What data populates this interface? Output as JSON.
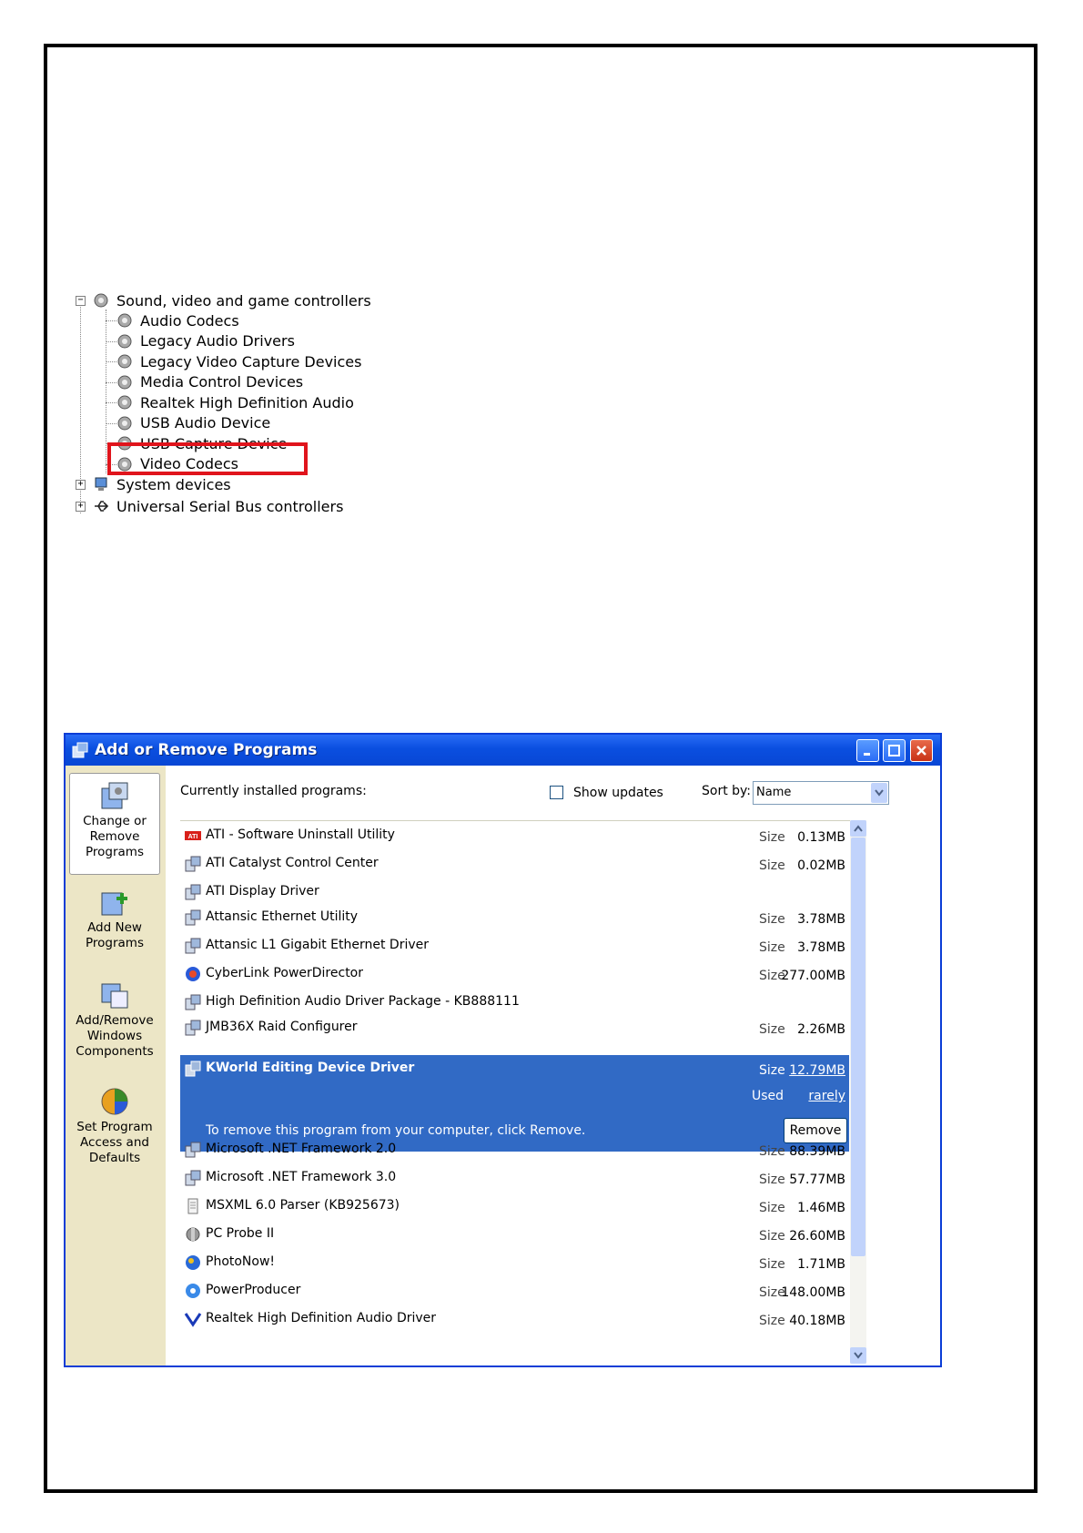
{
  "device_tree": {
    "root": {
      "label": "Sound, video and game controllers",
      "expander": "−"
    },
    "children": [
      "Audio Codecs",
      "Legacy Audio Drivers",
      "Legacy Video Capture Devices",
      "Media Control Devices",
      "Realtek High Definition Audio",
      "USB Audio Device",
      "USB Capture Device",
      "Video Codecs"
    ],
    "highlighted": "USB Capture Device",
    "siblings": [
      {
        "label": "System devices",
        "expander": "+"
      },
      {
        "label": "Universal Serial Bus controllers",
        "expander": "+"
      }
    ],
    "highlight_color": "#e0141c"
  },
  "window": {
    "title": "Add or Remove Programs",
    "title_color": "#0a4fe0",
    "sidebar": [
      {
        "label": "Change or Remove Programs",
        "icon": "change-remove-programs-icon",
        "active": true
      },
      {
        "label": "Add New Programs",
        "icon": "add-new-programs-icon",
        "active": false
      },
      {
        "label": "Add/Remove Windows Components",
        "icon": "windows-components-icon",
        "active": false
      },
      {
        "label": "Set Program Access and Defaults",
        "icon": "program-access-icon",
        "active": false
      }
    ],
    "header": {
      "installed_label": "Currently installed programs:",
      "show_updates_label": "Show updates",
      "show_updates_checked": false,
      "sort_label": "Sort by:",
      "sort_value": "Name"
    },
    "programs_before": [
      {
        "name": "ATI - Software Uninstall Utility",
        "size_label": "Size",
        "size": "0.13MB",
        "icon": "ati-icon"
      },
      {
        "name": "ATI Catalyst Control Center",
        "size_label": "Size",
        "size": "0.02MB",
        "icon": "installer-icon"
      },
      {
        "name": "ATI Display Driver",
        "size_label": "",
        "size": "",
        "icon": "installer-icon"
      },
      {
        "name": "Attansic Ethernet Utility",
        "size_label": "Size",
        "size": "3.78MB",
        "icon": "installer-icon"
      },
      {
        "name": "Attansic L1 Gigabit Ethernet Driver",
        "size_label": "Size",
        "size": "3.78MB",
        "icon": "installer-icon"
      },
      {
        "name": "CyberLink PowerDirector",
        "size_label": "Size",
        "size": "277.00MB",
        "icon": "cyberlink-icon"
      },
      {
        "name": "High Definition Audio Driver Package - KB888111",
        "size_label": "",
        "size": "",
        "icon": "installer-icon"
      },
      {
        "name": "JMB36X Raid Configurer",
        "size_label": "Size",
        "size": "2.26MB",
        "icon": "installer-icon"
      }
    ],
    "selected_program": {
      "name": "KWorld Editing Device Driver",
      "size_label": "Size",
      "size": "12.79MB",
      "used_label": "Used",
      "used": "rarely",
      "message": "To remove this program from your computer, click Remove.",
      "remove_label": "Remove",
      "highlight_color": "#316ac5"
    },
    "programs_after": [
      {
        "name": "Microsoft .NET Framework 2.0",
        "size_label": "Size",
        "size": "88.39MB",
        "icon": "installer-icon"
      },
      {
        "name": "Microsoft .NET Framework 3.0",
        "size_label": "Size",
        "size": "57.77MB",
        "icon": "installer-icon"
      },
      {
        "name": "MSXML 6.0 Parser (KB925673)",
        "size_label": "Size",
        "size": "1.46MB",
        "icon": "document-icon"
      },
      {
        "name": "PC Probe II",
        "size_label": "Size",
        "size": "26.60MB",
        "icon": "probe-icon"
      },
      {
        "name": "PhotoNow!",
        "size_label": "Size",
        "size": "1.71MB",
        "icon": "photonow-icon"
      },
      {
        "name": "PowerProducer",
        "size_label": "Size",
        "size": "148.00MB",
        "icon": "powerproducer-icon"
      },
      {
        "name": "Realtek High Definition Audio Driver",
        "size_label": "Size",
        "size": "40.18MB",
        "icon": "realtek-icon"
      }
    ]
  }
}
